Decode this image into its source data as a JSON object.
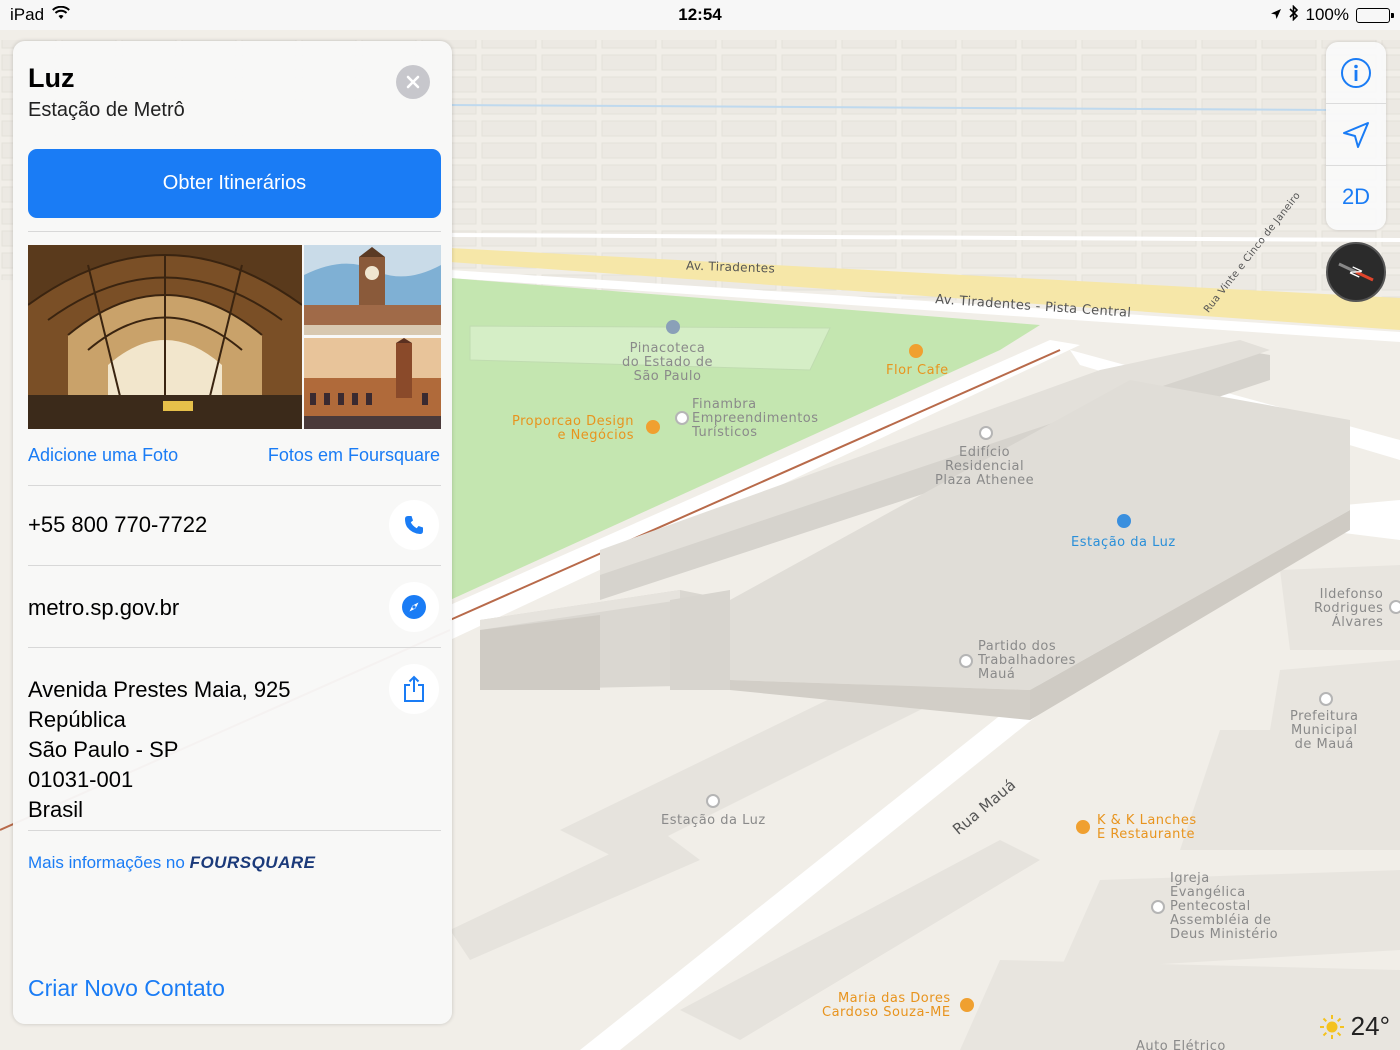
{
  "status_bar": {
    "device": "iPad",
    "time": "12:54",
    "battery": "100%"
  },
  "card": {
    "title": "Luz",
    "subtitle": "Estação de Metrô",
    "directions_label": "Obter Itinerários",
    "add_photo_label": "Adicione uma Foto",
    "foursquare_photos_label": "Fotos em Foursquare",
    "phone": "+55 800 770-7722",
    "website": "metro.sp.gov.br",
    "address_lines": [
      "Avenida Prestes Maia, 925",
      "República",
      "São Paulo - SP",
      "01031-001",
      "Brasil"
    ],
    "more_info_prefix": "Mais informações no",
    "more_info_brand": "FOURSQUARE",
    "new_contact_label": "Criar Novo Contato"
  },
  "map_controls": {
    "info_icon": "info-icon",
    "location_icon": "location-arrow-icon",
    "view_mode_label": "2D",
    "compass_icon": "compass-icon"
  },
  "weather": {
    "icon": "sun-icon",
    "temperature": "24°"
  },
  "map_labels": {
    "road_tiradentes": "Av. Tiradentes",
    "road_tiradentes_central": "Av. Tiradentes - Pista Central",
    "road_vinte_cinco": "Rua Vinte e Cinco de Janeiro",
    "road_maua": "Rua Mauá",
    "poi_pinacoteca": [
      "Pinacoteca",
      "do Estado de",
      "São Paulo"
    ],
    "poi_flor_cafe": "Flor Cafe",
    "poi_proporcao": [
      "Proporcao Design",
      "e Negócios"
    ],
    "poi_finambra": [
      "Finambra",
      "Empreendimentos",
      "Turísticos"
    ],
    "poi_edificio": [
      "Edifício",
      "Residencial",
      "Plaza Athenee"
    ],
    "poi_estacao_luz_metro": "Estação da Luz",
    "poi_ildefonso": [
      "Ildefonso",
      "Rodrigues",
      "Álvares"
    ],
    "poi_partido": [
      "Partido dos",
      "Trabalhadores",
      "Mauá"
    ],
    "poi_prefeitura": [
      "Prefeitura",
      "Municipal",
      "de Mauá"
    ],
    "poi_estacao_luz": "Estação da Luz",
    "poi_kk": [
      "K & K Lanches",
      "E Restaurante"
    ],
    "poi_igreja": [
      "Igreja",
      "Evangélica",
      "Pentecostal",
      "Assembléia de",
      "Deus Ministério"
    ],
    "poi_maria": [
      "Maria das Dores",
      "Cardoso Souza-ME"
    ],
    "poi_auto": "Auto Elétrico"
  },
  "colors": {
    "accent": "#1a7cf5",
    "park": "#c4e6b0",
    "road_yellow": "#f6e7a8",
    "building": "#e3e0da",
    "foursquare": "#1b3a7a"
  }
}
